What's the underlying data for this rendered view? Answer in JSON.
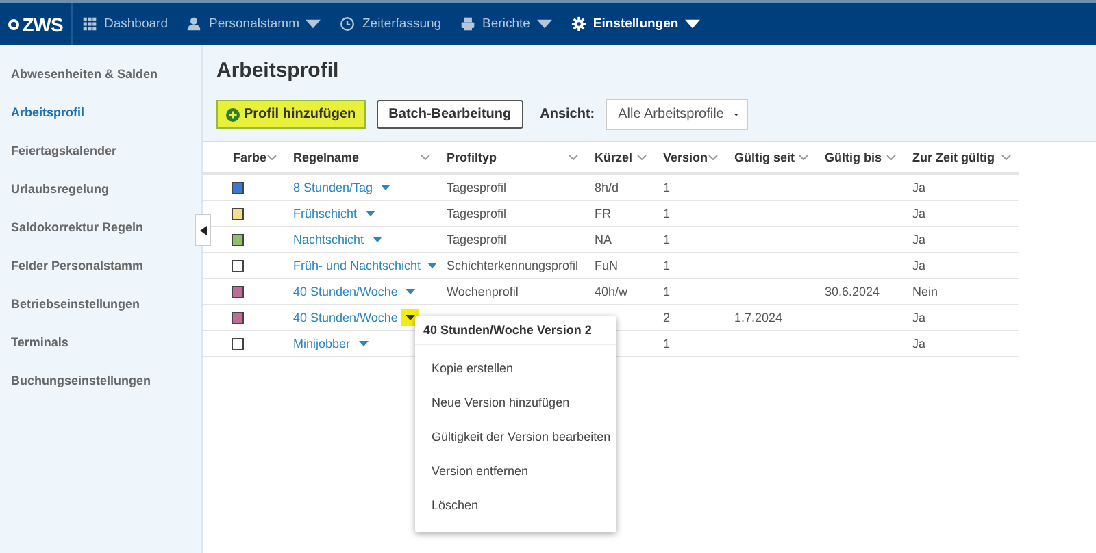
{
  "nav": {
    "logo": "ZWS",
    "items": [
      {
        "label": "Dashboard",
        "dropdown": false,
        "selected": false
      },
      {
        "label": "Personalstamm",
        "dropdown": true,
        "selected": false
      },
      {
        "label": "Zeiterfassung",
        "dropdown": false,
        "selected": false
      },
      {
        "label": "Berichte",
        "dropdown": true,
        "selected": false
      },
      {
        "label": "Einstellungen",
        "dropdown": true,
        "selected": true
      }
    ]
  },
  "sidebar": {
    "items": [
      {
        "label": "Abwesenheiten & Salden",
        "selected": false
      },
      {
        "label": "Arbeitsprofil",
        "selected": true
      },
      {
        "label": "Feiertagskalender",
        "selected": false
      },
      {
        "label": "Urlaubsregelung",
        "selected": false
      },
      {
        "label": "Saldokorrektur Regeln",
        "selected": false
      },
      {
        "label": "Felder Personalstamm",
        "selected": false
      },
      {
        "label": "Betriebseinstellungen",
        "selected": false
      },
      {
        "label": "Terminals",
        "selected": false
      },
      {
        "label": "Buchungseinstellungen",
        "selected": false
      }
    ]
  },
  "title": "Arbeitsprofil",
  "toolbar": {
    "add_button": "Profil hinzufügen",
    "batch_button": "Batch-Bearbeitung",
    "view_label": "Ansicht:",
    "view_value": "Alle Arbeitsprofile"
  },
  "table": {
    "columns": [
      "Farbe",
      "Regelname",
      "Profiltyp",
      "Kürzel",
      "Version",
      "Gültig seit",
      "Gültig bis",
      "Zur Zeit gültig"
    ],
    "rows": [
      {
        "color": "#3a78d8",
        "name": "8 Stunden/Tag",
        "type": "Tagesprofil",
        "short": "8h/d",
        "version": "1",
        "current": "Ja",
        "selected": false
      },
      {
        "color": "#f6dc8c",
        "name": "Frühschicht",
        "type": "Tagesprofil",
        "short": "FR",
        "version": "1",
        "current": "Ja",
        "selected": false
      },
      {
        "color": "#8fbf6a",
        "name": "Nachtschicht",
        "type": "Tagesprofil",
        "short": "NA",
        "version": "1",
        "current": "Ja",
        "selected": false
      },
      {
        "color": "#ffffff",
        "name": "Früh- und Nachtschicht",
        "type": "Schichterkennungsprofil",
        "short": "FuN",
        "version": "1",
        "current": "Ja",
        "selected": false
      },
      {
        "color": "#c06b9a",
        "name": "40 Stunden/Woche",
        "type": "Wochenprofil",
        "short": "40h/w",
        "version": "1",
        "valid_to": "30.6.2024",
        "current": "Nein",
        "selected": false
      },
      {
        "color": "#c06b9a",
        "name": "40 Stunden/Woche",
        "version": "2",
        "valid_from": "1.7.2024",
        "current": "Ja",
        "selected": true
      },
      {
        "color": "#ffffff",
        "name": "Minijobber",
        "version": "1",
        "current": "Ja",
        "selected": false
      }
    ]
  },
  "context_menu": {
    "title": "40 Stunden/Woche Version 2",
    "items": [
      "Kopie erstellen",
      "Neue Version hinzufügen",
      "Gültigkeit der Version bearbeiten",
      "Version entfernen",
      "Löschen"
    ]
  }
}
